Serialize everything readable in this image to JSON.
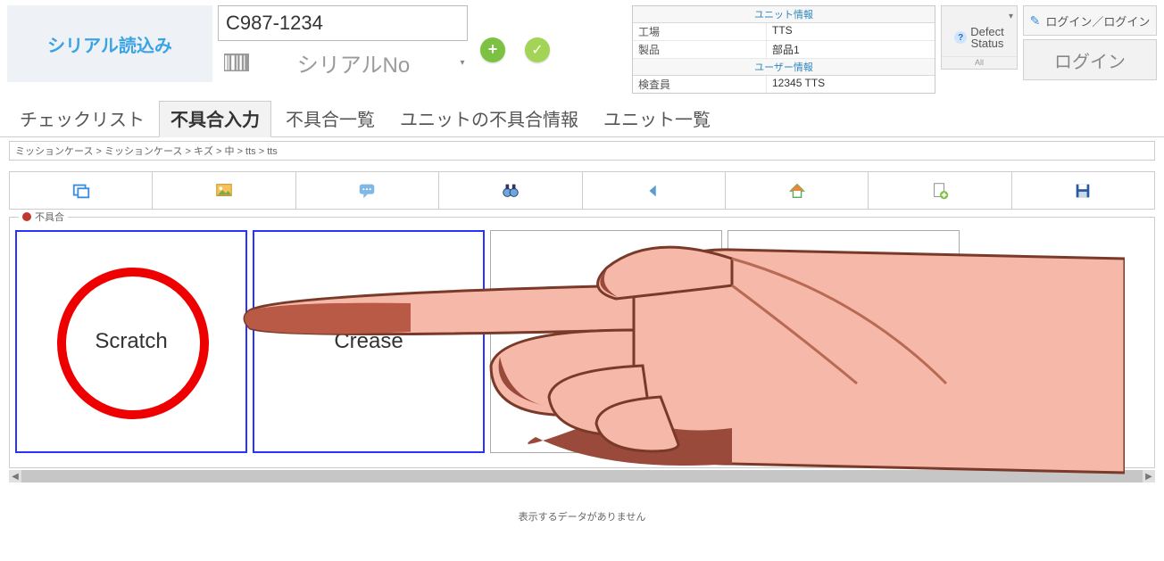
{
  "header": {
    "serial_load_btn": "シリアル読込み",
    "serial_code": "C987-1234",
    "serial_no_label": "シリアルNo"
  },
  "unit_info": {
    "title": "ユニット情報",
    "rows": [
      {
        "k": "工場",
        "v": "TTS"
      },
      {
        "k": "製品",
        "v": "部品1"
      }
    ],
    "user_title": "ユーザー情報",
    "user_rows": [
      {
        "k": "検査員",
        "v": "12345 TTS"
      }
    ]
  },
  "defect_status": {
    "label_line1": "Defect",
    "label_line2": "Status",
    "all": "All"
  },
  "login": {
    "link": "ログイン／ログイン",
    "button": "ログイン"
  },
  "tabs": [
    {
      "label": "チェックリスト",
      "active": false
    },
    {
      "label": "不具合入力",
      "active": true
    },
    {
      "label": "不具合一覧",
      "active": false
    },
    {
      "label": "ユニットの不具合情報",
      "active": false
    },
    {
      "label": "ユニット一覧",
      "active": false
    }
  ],
  "breadcrumb": "ミッションケース > ミッションケース > キズ > 中 > tts > tts",
  "defect_group": {
    "legend": "不具合",
    "cards": [
      {
        "label": "Scratch",
        "selected": true,
        "circled": true
      },
      {
        "label": "Crease",
        "selected": true,
        "circled": false
      },
      {
        "label": "",
        "selected": false,
        "circled": false
      },
      {
        "label": "",
        "selected": false,
        "circled": false
      }
    ]
  },
  "nodata": "表示するデータがありません"
}
